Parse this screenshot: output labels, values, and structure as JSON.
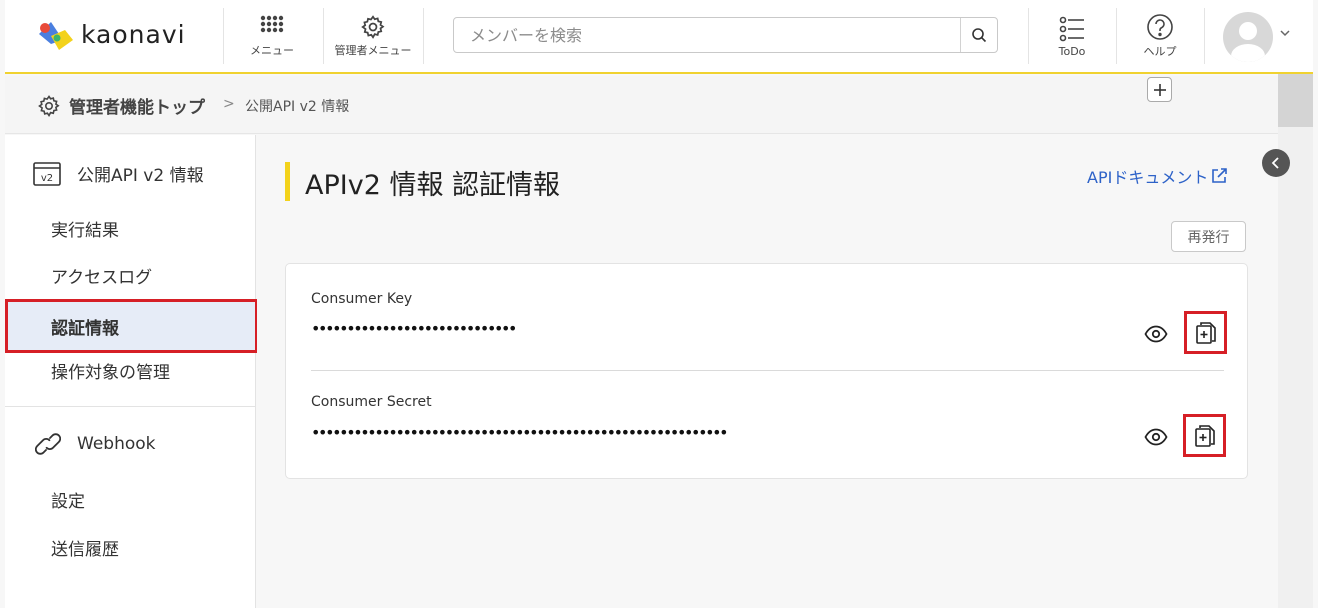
{
  "header": {
    "logo_text": "kaonavi",
    "menu_label": "メニュー",
    "admin_menu_label": "管理者メニュー",
    "search_placeholder": "メンバーを検索",
    "todo_label": "ToDo",
    "help_label": "ヘルプ"
  },
  "breadcrumb": {
    "home": "管理者機能トップ",
    "separator": ">",
    "current": "公開API v2 情報"
  },
  "sidebar": {
    "section_api": "公開API v2 情報",
    "api_icon_text": "v2",
    "api_items": [
      "実行結果",
      "アクセスログ",
      "認証情報",
      "操作対象の管理"
    ],
    "active_item": "認証情報",
    "section_webhook": "Webhook",
    "webhook_items": [
      "設定",
      "送信履歴"
    ]
  },
  "main": {
    "title": "APIv2 情報 認証情報",
    "doc_link": "APIドキュメント",
    "reissue_label": "再発行",
    "credentials": [
      {
        "label": "Consumer Key",
        "value": "•••••••••••••••••••••••••••••"
      },
      {
        "label": "Consumer Secret",
        "value": "•••••••••••••••••••••••••••••••••••••••••••••••••••••••••••"
      }
    ]
  },
  "colors": {
    "accent_yellow": "#f3d21b",
    "link_blue": "#2d62c8",
    "highlight_red": "#d61f26",
    "active_bg": "#e6ecf7"
  }
}
